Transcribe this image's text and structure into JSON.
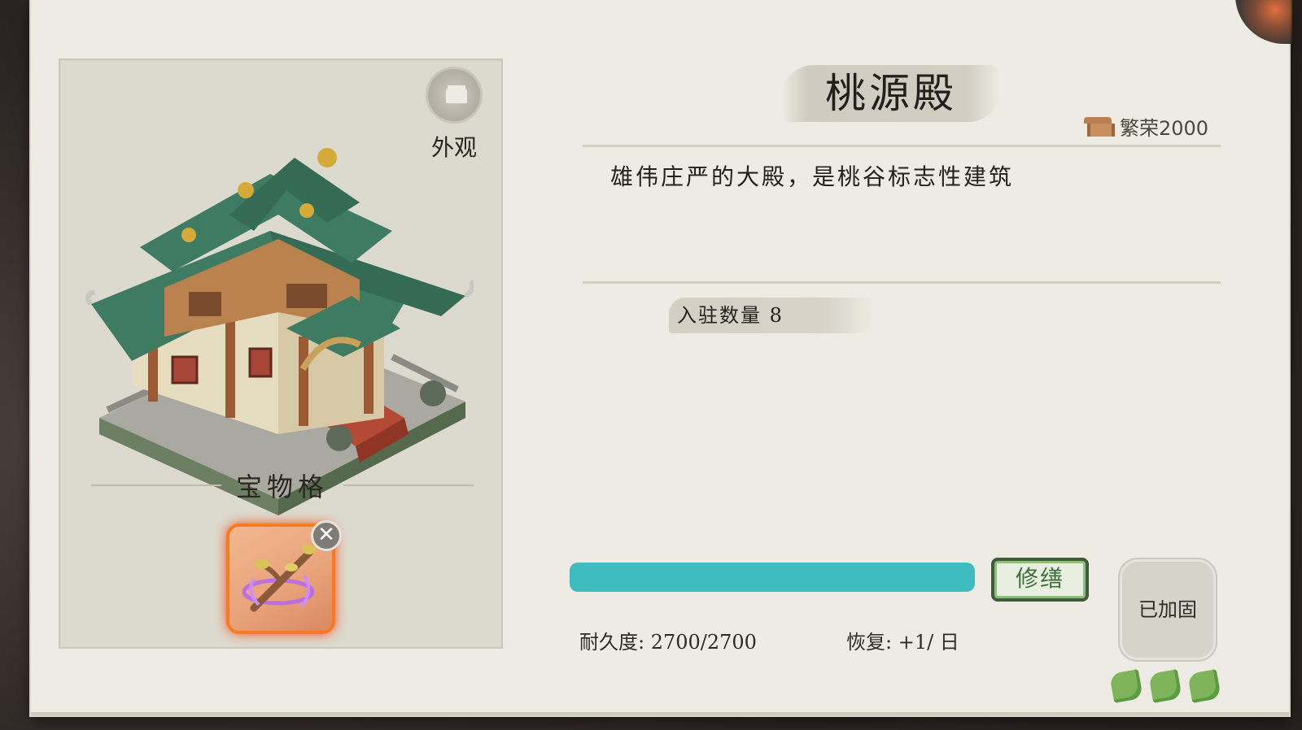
{
  "building": {
    "name": "桃源殿",
    "prosperity": "繁荣2000",
    "description": "雄伟庄严的大殿，是桃谷标志性建筑",
    "residents": "入驻数量 8"
  },
  "appearance": {
    "label": "外观",
    "icon": "building-icon"
  },
  "treasure": {
    "title": "宝物格",
    "slot_item": "glowing-branch-icon",
    "remove_icon": "close-icon",
    "remove_glyph": "✕"
  },
  "durability": {
    "text": "耐久度: 2700/2700",
    "current": 2700,
    "max": 2700,
    "recovery": "恢复: +1/ 日"
  },
  "repair_button": "修缮",
  "reinforced_label": "已加固",
  "colors": {
    "durability_bar": "#3fbcbe",
    "repair_border": "#3f5b3c",
    "leaf": "#7fb45a",
    "slot_glow": "#f57a26"
  }
}
